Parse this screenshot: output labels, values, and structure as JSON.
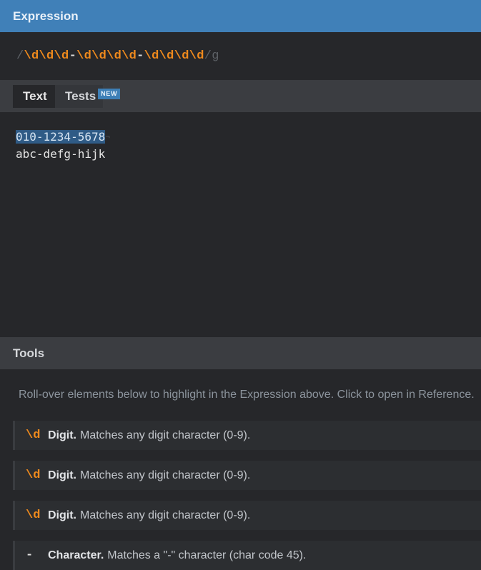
{
  "expression": {
    "header": "Expression",
    "open_delim": "/",
    "tokens": [
      {
        "text": "\\d",
        "kind": "digit"
      },
      {
        "text": "\\d",
        "kind": "digit"
      },
      {
        "text": "\\d",
        "kind": "digit"
      },
      {
        "text": "-",
        "kind": "char"
      },
      {
        "text": "\\d",
        "kind": "digit"
      },
      {
        "text": "\\d",
        "kind": "digit"
      },
      {
        "text": "\\d",
        "kind": "digit"
      },
      {
        "text": "\\d",
        "kind": "digit"
      },
      {
        "text": "-",
        "kind": "char"
      },
      {
        "text": "\\d",
        "kind": "digit"
      },
      {
        "text": "\\d",
        "kind": "digit"
      },
      {
        "text": "\\d",
        "kind": "digit"
      },
      {
        "text": "\\d",
        "kind": "digit"
      }
    ],
    "close_delim": "/",
    "flags": "g"
  },
  "tabs": {
    "text_label": "Text",
    "tests_label": "Tests",
    "new_badge": "NEW"
  },
  "text": {
    "line1_match": "010-1234-5678",
    "line1_eol": "¬",
    "line2": "abc-defg-hijk"
  },
  "tools": {
    "header": "Tools",
    "hint": "Roll-over elements below to highlight in the Expression above. Click to open in Reference.",
    "items": [
      {
        "token": "\\d",
        "name": "Digit.",
        "desc": "Matches any digit character (0-9).",
        "kind": "digit"
      },
      {
        "token": "\\d",
        "name": "Digit.",
        "desc": "Matches any digit character (0-9).",
        "kind": "digit"
      },
      {
        "token": "\\d",
        "name": "Digit.",
        "desc": "Matches any digit character (0-9).",
        "kind": "digit"
      },
      {
        "token": "-",
        "name": "Character.",
        "desc": "Matches a \"-\" character (char code 45).",
        "kind": "char"
      }
    ]
  },
  "colors": {
    "expression_header": "#4080b8",
    "digit_token": "#ef8a1d",
    "match_highlight": "#2f5b86",
    "background": "#26272a"
  }
}
